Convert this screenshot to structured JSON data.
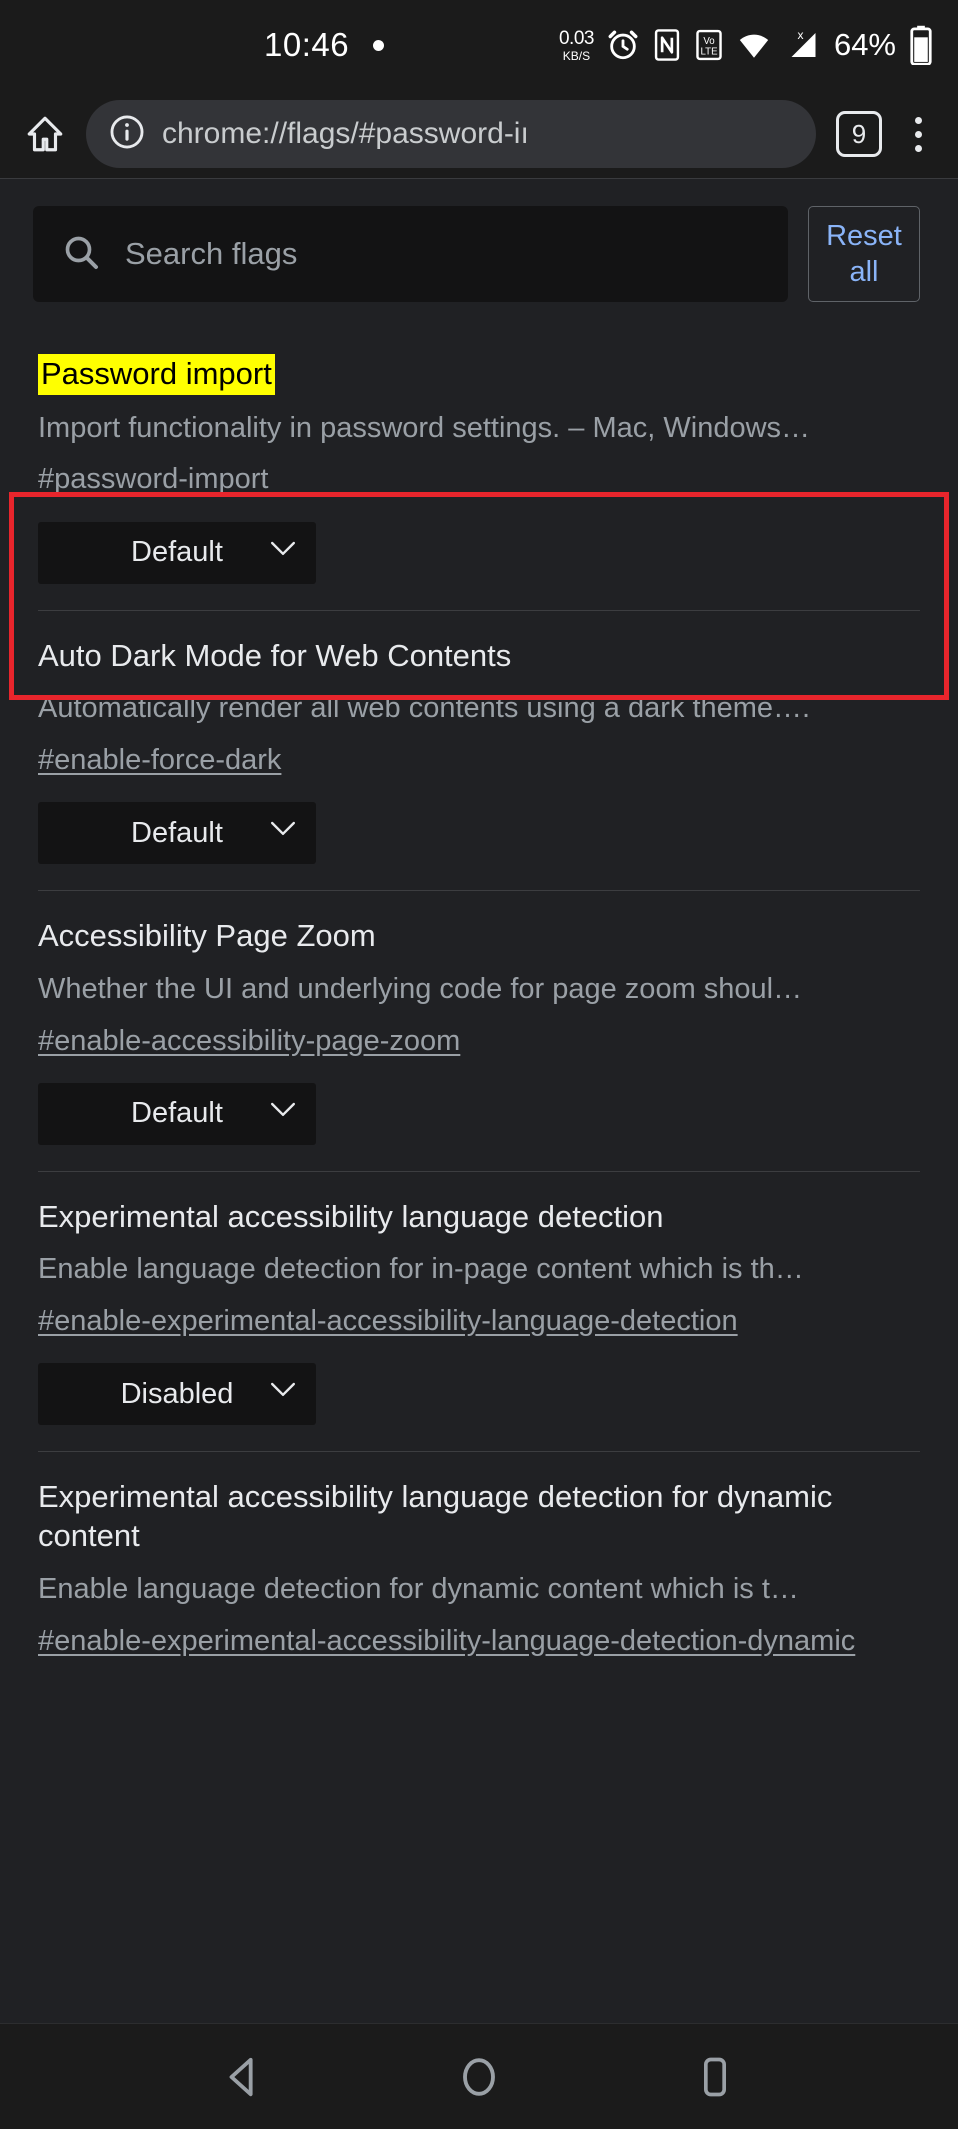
{
  "status_bar": {
    "time": "10:46",
    "net_speed_value": "0.03",
    "net_speed_unit": "KB/S",
    "icons": [
      "alarm-icon",
      "nfc-icon",
      "volte-icon",
      "wifi-icon",
      "cellular-signal-icon"
    ],
    "battery_percent": "64%"
  },
  "toolbar": {
    "home_icon": "home-icon",
    "site_info_icon": "info-circle-icon",
    "url": "chrome://flags/#password-iı",
    "tab_count": "9",
    "menu_icon": "overflow-menu-icon"
  },
  "search": {
    "icon": "search-icon",
    "placeholder": "Search flags",
    "value": ""
  },
  "reset_all_label": "Reset all",
  "colors": {
    "page_background": "#202124",
    "chrome_background": "#1b1b1b",
    "accent_link": "#8ab4f8",
    "highlight_background": "#ffff00",
    "highlight_text": "#000000",
    "annotation_box": "#e8252c",
    "primary_text": "#e8eaed",
    "secondary_text": "#9aa0a6"
  },
  "flags": [
    {
      "title": "Password import",
      "highlighted": true,
      "description": "Import functionality in password settings. – Mac, Windows…",
      "link": "#password-import",
      "select_value": "Default"
    },
    {
      "title": "Auto Dark Mode for Web Contents",
      "highlighted": false,
      "description": "Automatically render all web contents using a dark theme….",
      "link": "#enable-force-dark",
      "select_value": "Default"
    },
    {
      "title": "Accessibility Page Zoom",
      "highlighted": false,
      "description": "Whether the UI and underlying code for page zoom shoul…",
      "link": "#enable-accessibility-page-zoom",
      "select_value": "Default"
    },
    {
      "title": "Experimental accessibility language detection",
      "highlighted": false,
      "description": "Enable language detection for in-page content which is th…",
      "link": "#enable-experimental-accessibility-language-detection",
      "select_value": "Disabled"
    },
    {
      "title": "Experimental accessibility language detection for dynamic content",
      "highlighted": false,
      "description": "Enable language detection for dynamic content which is t…",
      "link": "#enable-experimental-accessibility-language-detection-dynamic",
      "select_value": ""
    }
  ],
  "navbar": {
    "back_icon": "back-triangle-icon",
    "home_icon": "home-circle-icon",
    "recents_icon": "recents-square-icon"
  }
}
